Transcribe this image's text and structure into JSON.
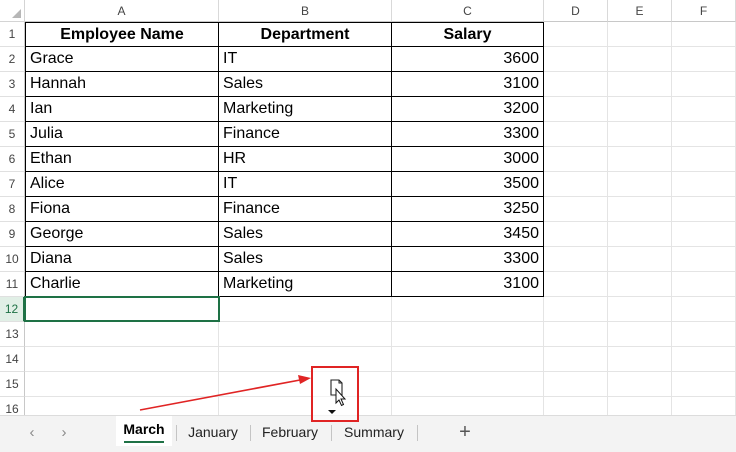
{
  "columns": [
    "A",
    "B",
    "C",
    "D",
    "E",
    "F"
  ],
  "rows": [
    "1",
    "2",
    "3",
    "4",
    "5",
    "6",
    "7",
    "8",
    "9",
    "10",
    "11",
    "12",
    "13",
    "14",
    "15",
    "16"
  ],
  "active_row": "12",
  "table": {
    "headers": [
      "Employee Name",
      "Department",
      "Salary"
    ],
    "records": [
      [
        "Grace",
        "IT",
        "3600"
      ],
      [
        "Hannah",
        "Sales",
        "3100"
      ],
      [
        "Ian",
        "Marketing",
        "3200"
      ],
      [
        "Julia",
        "Finance",
        "3300"
      ],
      [
        "Ethan",
        "HR",
        "3000"
      ],
      [
        "Alice",
        "IT",
        "3500"
      ],
      [
        "Fiona",
        "Finance",
        "3250"
      ],
      [
        "George",
        "Sales",
        "3450"
      ],
      [
        "Diana",
        "Sales",
        "3300"
      ],
      [
        "Charlie",
        "Marketing",
        "3100"
      ]
    ]
  },
  "sheet_tabs": {
    "prev_icon": "chevron-left-icon",
    "next_icon": "chevron-right-icon",
    "add_icon": "plus-icon",
    "add_symbol": "+",
    "tabs": [
      {
        "label": "March",
        "active": true
      },
      {
        "label": "January",
        "active": false
      },
      {
        "label": "February",
        "active": false
      },
      {
        "label": "Summary",
        "active": false
      }
    ]
  },
  "annotation": {
    "arrow_color": "#e02424",
    "box_color": "#e02424",
    "icon": "drag-sheet-cursor-icon"
  },
  "colors": {
    "accent": "#1e7145",
    "gridline": "#e4e4e4",
    "tabbar_bg": "#f3f3f3"
  }
}
